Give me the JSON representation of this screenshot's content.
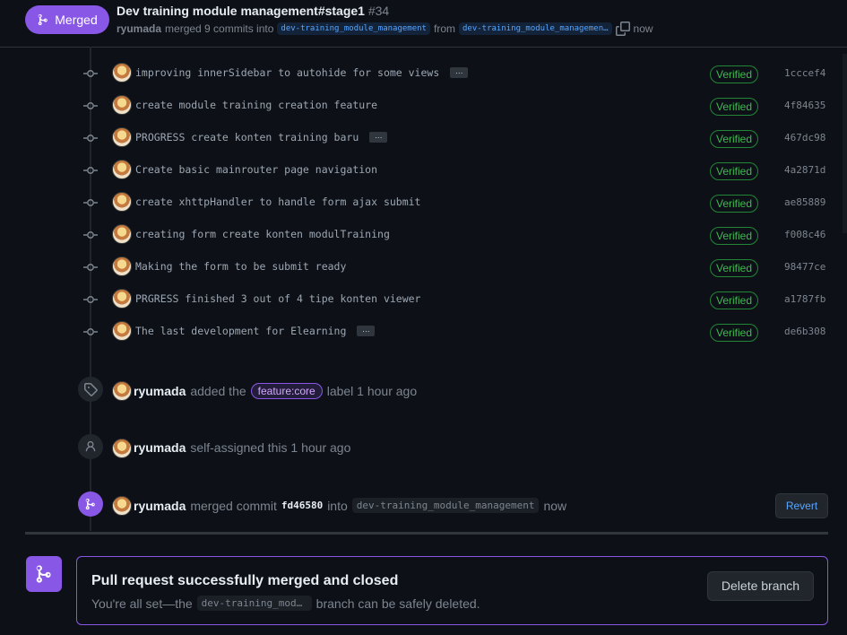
{
  "header": {
    "state_label": "Merged",
    "title": "Dev training module management#stage1",
    "number": "#34",
    "author": "ryumada",
    "merged_text": "merged 9 commits into",
    "base_branch": "dev-training_module_management",
    "from_text": "from",
    "head_branch": "dev-training_module_managemen…",
    "time": "now"
  },
  "commits": [
    {
      "message": "improving innerSidebar to autohide for some views",
      "has_more": true,
      "badge": "Verified",
      "sha": "1cccef4"
    },
    {
      "message": "create module training creation feature",
      "has_more": false,
      "badge": "Verified",
      "sha": "4f84635"
    },
    {
      "message": "PROGRESS create konten training baru",
      "has_more": true,
      "badge": "Verified",
      "sha": "467dc98"
    },
    {
      "message": "Create basic mainrouter page navigation",
      "has_more": false,
      "badge": "Verified",
      "sha": "4a2871d"
    },
    {
      "message": "create xhttpHandler to handle form ajax submit",
      "has_more": false,
      "badge": "Verified",
      "sha": "ae85889"
    },
    {
      "message": "creating form create konten modulTraining",
      "has_more": false,
      "badge": "Verified",
      "sha": "f008c46"
    },
    {
      "message": "Making the form to be submit ready",
      "has_more": false,
      "badge": "Verified",
      "sha": "98477ce"
    },
    {
      "message": "PRGRESS finished 3 out of 4 tipe konten viewer",
      "has_more": false,
      "badge": "Verified",
      "sha": "a1787fb"
    },
    {
      "message": "The last development for Elearning",
      "has_more": true,
      "badge": "Verified",
      "sha": "de6b308"
    }
  ],
  "events": {
    "label": {
      "actor": "ryumada",
      "pre": "added the",
      "label": "feature:core",
      "post": "label 1 hour ago"
    },
    "assign": {
      "actor": "ryumada",
      "text": "self-assigned this 1 hour ago"
    },
    "merge": {
      "actor": "ryumada",
      "pre": "merged commit",
      "commit": "fd46580",
      "mid": "into",
      "branch": "dev-training_module_management",
      "time": "now",
      "revert_label": "Revert"
    }
  },
  "merge_box": {
    "title": "Pull request successfully merged and closed",
    "sub_pre": "You're all set—the",
    "branch": "dev-training_module_management",
    "sub_post": "branch can be safely deleted.",
    "delete_label": "Delete branch"
  },
  "colors": {
    "accent_purple": "#8957e5",
    "verified_green": "#3fb950",
    "link_blue": "#58a6ff",
    "background": "#0d1117"
  }
}
